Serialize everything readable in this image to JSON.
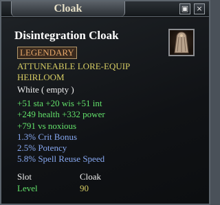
{
  "window": {
    "title": "Cloak",
    "buttons": [
      "▣",
      "×"
    ]
  },
  "item": {
    "name": "Disintegration Cloak",
    "icon": "cloak-icon",
    "rarity": "LEGENDARY",
    "flags_line1": "ATTUNEABLE   LORE-EQUIP",
    "flags_line2": "HEIRLOOM",
    "adorn": "White ( empty )",
    "stats": [
      "+51 sta  +20 wis  +51 int",
      "+249 health  +332 power",
      "+791 vs noxious"
    ],
    "modifiers": [
      "1.3% Crit Bonus",
      "2.5% Potency",
      "5.8% Spell Reuse Speed"
    ],
    "slot_label": "Slot",
    "slot_value": "Cloak",
    "level_label": "Level",
    "level_value": "90"
  },
  "colors": {
    "rarity": "#e7a86a",
    "flags": "#d6cc63",
    "stats": "#63e36b",
    "modifiers": "#87a8f0"
  }
}
